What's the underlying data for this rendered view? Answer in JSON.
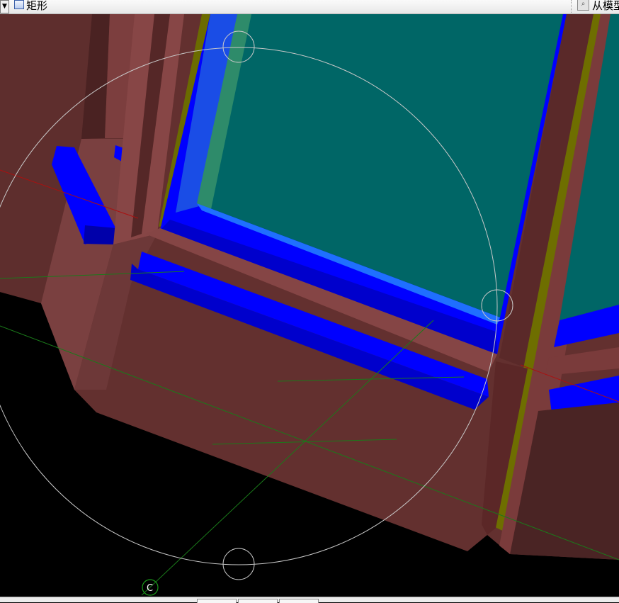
{
  "toolbar": {
    "dropdown_glyph": "▼",
    "shape_icon": "rectangle-icon",
    "shape_label": "矩形",
    "model_icon": "magnifier-icon",
    "model_label": "从模型"
  },
  "viewport": {
    "snap_marker_label": "C",
    "background_color": "#000000",
    "frame_color": "#63302f",
    "glass_color": "#006666",
    "glazing_bead_color": "#0000ff"
  }
}
